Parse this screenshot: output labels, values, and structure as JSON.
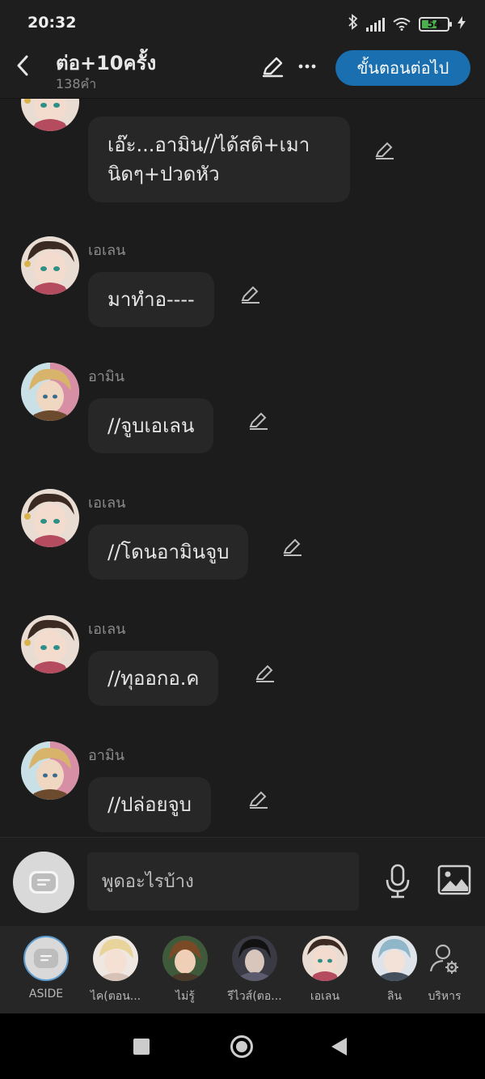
{
  "status": {
    "time": "20:32",
    "battery": "54"
  },
  "header": {
    "title": "ต่อ+10ครั้ง",
    "subtitle": "138คำ",
    "next_button": "ขั้นตอนต่อไป"
  },
  "messages": [
    {
      "speaker": "",
      "avatar": "eren",
      "text_lines": [
        "เอ๊ะ...อามิน//ได้สติ+เมา",
        "นิดๆ+ปวดหัว"
      ]
    },
    {
      "speaker": "เอเลน",
      "avatar": "eren",
      "text": "มาทำอ----"
    },
    {
      "speaker": "อามิน",
      "avatar": "armin",
      "text": "//จูบเอเลน"
    },
    {
      "speaker": "เอเลน",
      "avatar": "eren",
      "text": "//โดนอามินจูบ"
    },
    {
      "speaker": "เอเลน",
      "avatar": "eren",
      "text": "//ทุออกอ.ค"
    },
    {
      "speaker": "อามิน",
      "avatar": "armin",
      "text": "//ปล่อยจูบ"
    }
  ],
  "input": {
    "placeholder": "พูดอะไรบ้าง"
  },
  "characters": [
    {
      "label": "ASIDE"
    },
    {
      "label": "ไค(ตอน..."
    },
    {
      "label": "ไม่รู้"
    },
    {
      "label": "รีไวส์(ตอ..."
    },
    {
      "label": "เอเลน"
    },
    {
      "label": "ลิน"
    },
    {
      "label": "บริหาร"
    }
  ],
  "colors": {
    "accent": "#1a6fb0",
    "background": "#1c1c1c",
    "bubble": "#272727"
  }
}
